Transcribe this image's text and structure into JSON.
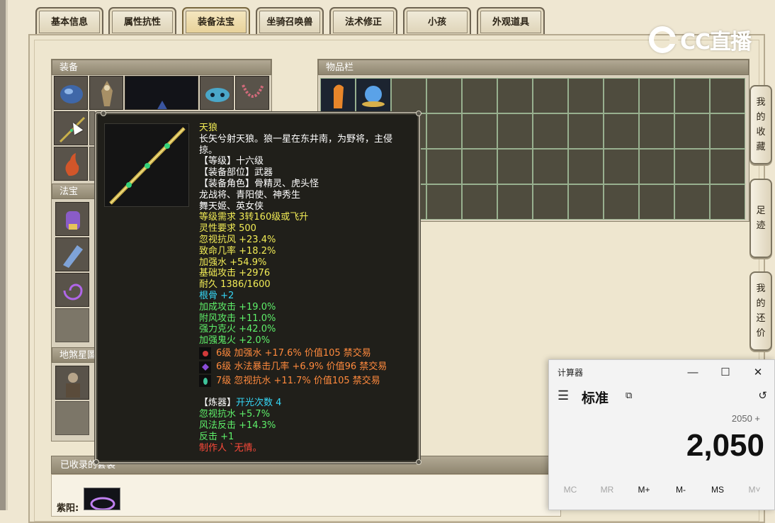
{
  "tabs": [
    {
      "label": "基本信息"
    },
    {
      "label": "属性抗性"
    },
    {
      "label": "装备法宝",
      "active": true
    },
    {
      "label": "坐骑召唤兽"
    },
    {
      "label": "法术修正"
    },
    {
      "label": "小孩"
    },
    {
      "label": "外观道具"
    }
  ],
  "watermark": {
    "text": "CC直播"
  },
  "equipment_panel": {
    "title": "装备"
  },
  "treasure_panel": {
    "title": "法宝"
  },
  "nightfiend_panel": {
    "title": "地煞星圖"
  },
  "inventory_panel": {
    "title": "物品栏"
  },
  "side_buttons": [
    {
      "label": [
        "我",
        "的",
        "收",
        "藏"
      ]
    },
    {
      "label": [
        "足",
        "迹"
      ]
    },
    {
      "label": [
        "我",
        "的",
        "还",
        "价"
      ]
    }
  ],
  "collected": {
    "title": "已收录的套装",
    "row_label": "紫阳:"
  },
  "tooltip": {
    "name": "天狼",
    "description": [
      "长矢兮射天狼。狼一星在东井南，为野将，主侵",
      "掠。"
    ],
    "level": "【等级】十六级",
    "slot": "【装备部位】武器",
    "roles": [
      "【装备角色】骨精灵、虎头怪",
      "龙战将、青阳使、神秀生",
      "舞天姬、英女侠"
    ],
    "requirements": [
      "等级需求 3转160级或飞升",
      "灵性要求 500"
    ],
    "base_stats": [
      "忽视抗风 +23.4%",
      "致命几率 +18.2%",
      "加强水 +54.9%",
      "基础攻击 +2976",
      "耐久 1386/1600"
    ],
    "bone": "根骨 +2",
    "extra_stats": [
      "加成攻击 +19.0%",
      "附风攻击 +11.0%",
      "强力克火 +42.0%",
      "加强鬼火 +2.0%"
    ],
    "gems": [
      {
        "text": "6级 加强水 +17.6% 价值105 禁交易",
        "icon": "red-gem-icon",
        "color": "#d23a3a"
      },
      {
        "text": "6级 水法暴击几率 +6.9% 价值96 禁交易",
        "icon": "purple-gem-icon",
        "color": "#8a4cd8"
      },
      {
        "text": "7级 忽视抗水 +11.7% 价值105 禁交易",
        "icon": "green-gem-icon",
        "color": "#3ec39a"
      }
    ],
    "refine_label": "【炼器】",
    "refine_value": "开光次数 4",
    "refine_stats": [
      "忽视抗水 +5.7%",
      "风法反击 +14.3%",
      "反击 +1"
    ],
    "maker": "制作人 `无情。"
  },
  "calculator": {
    "title": "计算器",
    "mode": "标准",
    "expression": "2050 +",
    "display": "2,050",
    "memory_buttons": [
      {
        "label": "MC",
        "enabled": false
      },
      {
        "label": "MR",
        "enabled": false
      },
      {
        "label": "M+",
        "enabled": true
      },
      {
        "label": "M-",
        "enabled": true
      },
      {
        "label": "MS",
        "enabled": true
      },
      {
        "label": "M˅",
        "enabled": false
      }
    ]
  }
}
